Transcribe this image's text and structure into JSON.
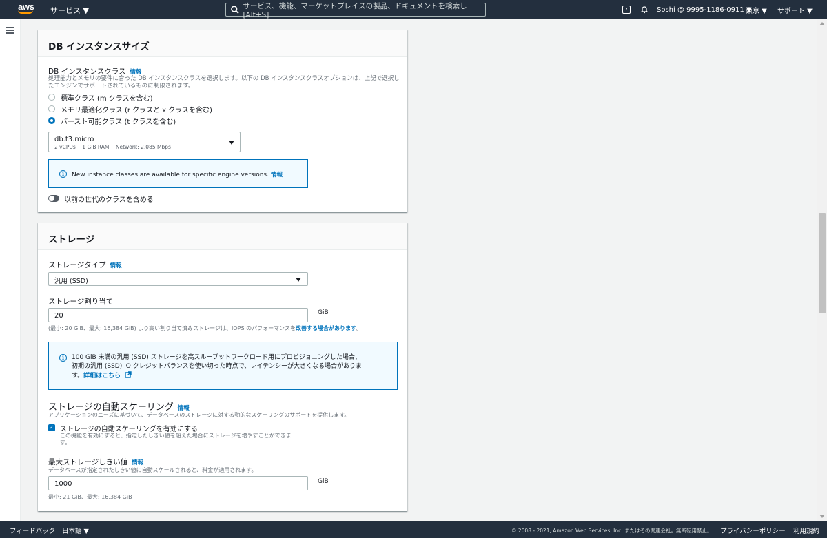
{
  "topnav": {
    "logo": "aws",
    "services": "サービス ▼",
    "search_placeholder": "サービス、機能、マーケットプレイスの製品、ドキュメントを検索し [Alt+S]",
    "account": "Soshi @ 9995-1186-0911 ▼",
    "region": "東京 ▼",
    "support": "サポート ▼"
  },
  "instance_size": {
    "title": "DB インスタンスサイズ",
    "class_label": "DB インスタンスクラス",
    "info": "情報",
    "class_desc": "処理能力とメモリの要件に合った DB インスタンスクラスを選択します。以下の DB インスタンスクラスオプションは、上記で選択したエンジンでサポートされているものに制限されます。",
    "options": [
      {
        "label": "標準クラス (m クラスを含む)",
        "selected": false
      },
      {
        "label": "メモリ最適化クラス (r クラスと x クラスを含む)",
        "selected": false
      },
      {
        "label": "バースト可能クラス (t クラスを含む)",
        "selected": true
      }
    ],
    "select_value": "db.t3.micro",
    "select_detail": "2 vCPUs    1 GiB RAM    Network: 2,085 Mbps",
    "notice": "New instance classes are available for specific engine versions.",
    "notice_info": "情報",
    "toggle_label": "以前の世代のクラスを含める",
    "toggle_on": false
  },
  "storage": {
    "title": "ストレージ",
    "type_label": "ストレージタイプ",
    "info": "情報",
    "type_value": "汎用 (SSD)",
    "alloc_label": "ストレージ割り当て",
    "alloc_value": "20",
    "unit": "GiB",
    "alloc_hint": "(最小: 20 GiB、最大: 16,384 GiB) より高い割り当て済みストレージは、IOPS のパフォーマンスを",
    "alloc_hint_link": "改善する場合があります",
    "alloc_hint_end": "。",
    "notice_line1": "100 GiB 未満の汎用 (SSD) ストレージを高スループットワークロード用にプロビジョニングした場合、",
    "notice_line2": "初期の汎用 (SSD) IO クレジットバランスを使い切った時点で、レイテンシーが大きくなる場合がありま",
    "notice_line3_pre": "す。",
    "notice_link": "詳細はこちら",
    "autoscale_title": "ストレージの自動スケーリング",
    "autoscale_info": "情報",
    "autoscale_desc": "アプリケーションのニーズに基づいて、データベースのストレージに対する動的なスケーリングのサポートを提供します。",
    "autoscale_check_label": "ストレージの自動スケーリングを有効にする",
    "autoscale_checked": true,
    "autoscale_check_desc1": "この機能を有効にすると、指定したしきい値を超えた場合にストレージを増やすことができま",
    "autoscale_check_desc2": "す。",
    "max_label": "最大ストレージしきい値",
    "max_info": "情報",
    "max_desc": "データベースが指定されたしきい値に自動スケールされると、料金が適用されます。",
    "max_value": "1000",
    "max_hint": "最小: 21 GiB、最大: 16,384 GiB"
  },
  "footer": {
    "feedback": "フィードバック",
    "language": "日本語 ▼",
    "copyright": "© 2008 - 2021, Amazon Web Services, Inc. またはその関連会社。無断転用禁止。",
    "privacy": "プライバシーポリシー",
    "terms": "利用規約"
  }
}
